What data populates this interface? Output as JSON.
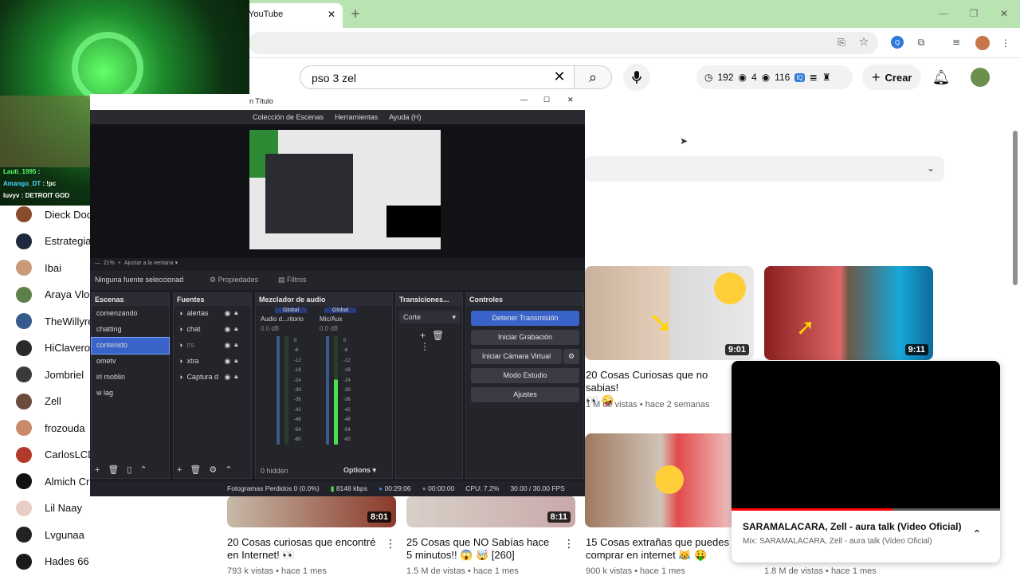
{
  "browser": {
    "tab_title": "YouTube",
    "icons": [
      "close-icon",
      "plus-icon",
      "minimize-icon",
      "maximize-icon",
      "window-close-icon",
      "star-icon",
      "extensions-icon",
      "profile-avatar"
    ]
  },
  "youtube": {
    "search_query": "pso 3 zel",
    "stats": {
      "a": "192",
      "b": "4",
      "c": "116"
    },
    "create_label": "Crear",
    "sidebar": [
      {
        "name": "Dieck Doc",
        "color": "#8a4a2e"
      },
      {
        "name": "Estrategia",
        "color": "#1d2a3e"
      },
      {
        "name": "Ibai",
        "color": "#c89a7a"
      },
      {
        "name": "Araya Vlog",
        "color": "#5f7f4a"
      },
      {
        "name": "TheWillyre",
        "color": "#355a8c"
      },
      {
        "name": "HiClavero",
        "color": "#2a2a2a"
      },
      {
        "name": "Jombriel",
        "color": "#3a3a3a"
      },
      {
        "name": "Zell",
        "color": "#6a4b3c"
      },
      {
        "name": "frozouda",
        "color": "#c98a6a"
      },
      {
        "name": "CarlosLCD",
        "color": "#b33a2a"
      },
      {
        "name": "Almich Cr",
        "color": "#111111"
      },
      {
        "name": "Lil Naay",
        "color": "#e8cfc4"
      },
      {
        "name": "Lvgunaa",
        "color": "#222222"
      },
      {
        "name": "Hades 66",
        "color": "#1a1a1a"
      }
    ],
    "videos": [
      {
        "title": "20 Cosas Curiosas que no sabias!",
        "emoji": "👀 🤪",
        "meta": "1 M de vistas • hace 2 semanas",
        "duration": "9:01"
      },
      {
        "title": "",
        "emoji": "",
        "meta": "",
        "duration": "9:11"
      },
      {
        "title": "20 Cosas curiosas que encontré en Internet! 👀",
        "meta": "793 k vistas • hace 1 mes",
        "duration": "8:01"
      },
      {
        "title": "25 Cosas que NO Sabías hace 5 minutos!! 😱 🤯 [260]",
        "meta": "1.5 M de vistas • hace 1 mes",
        "duration": "8:11"
      },
      {
        "title": "15 Cosas extrañas que puedes comprar en internet 😹 🤑",
        "meta": "900 k vistas • hace 1 mes",
        "duration": ""
      },
      {
        "title": "",
        "meta": "1.8 M de vistas • hace 1 mes",
        "duration": ""
      }
    ],
    "miniplayer": {
      "title": "SARAMALACARA, Zell - aura talk (Video Oficial)",
      "subtitle": "Mix: SARAMALACARA, Zell - aura talk (Video Oficial)",
      "progress": 0.6
    }
  },
  "stream_chat": [
    {
      "user": "Lauti_1995",
      "text": ":",
      "color": "#5dff6a"
    },
    {
      "user": "Amango_DT",
      "text": ": !pc",
      "color": "#4ad3ff"
    },
    {
      "user": "luvyv",
      "text": ": DETROIT GOD",
      "color": "#ffffff"
    }
  ],
  "obs": {
    "title": "n Título",
    "menu": [
      "Colección de Escenas",
      "Herramientas",
      "Ayuda (H)"
    ],
    "zoom": "21%",
    "fit": "Ajustar a la ventana",
    "no_source": "Ninguna fuente seleccionad",
    "properties": "Propiedades",
    "filters": "Filtros",
    "scenes_title": "Escenas",
    "scenes": [
      "comenzando",
      "chatting",
      "contenido",
      "ometv",
      "irl moblin",
      "w lag"
    ],
    "active_scene": 2,
    "sources_title": "Fuentes",
    "sources": [
      "alertas",
      "chat",
      "tts",
      "xtra",
      "Captura d"
    ],
    "mixer_title": "Mezclador de audio",
    "mixer_global": "Global",
    "mixer_channels": [
      "Audio d...ritorio",
      "Mic/Aux"
    ],
    "mixer_db": "0.0 dB",
    "mixer_scale": [
      "0",
      "-6",
      "-12",
      "-18",
      "-24",
      "-30",
      "-36",
      "-42",
      "-48",
      "-54",
      "-60"
    ],
    "hidden": "0 hidden",
    "options": "Options",
    "transitions_title": "Transiciones...",
    "transition": "Corte",
    "controls_title": "Controles",
    "controls": [
      "Detener Transmisión",
      "Iniciar Grabación",
      "Iniciar Cámara Virtual",
      "Modo Estudio",
      "Ajustes"
    ],
    "status": [
      "Fotogramas Perdidos 0 (0.0%)",
      "8148 kbps",
      "00:29:06",
      "00:00:00",
      "CPU: 7.2%",
      "30.00 / 30.00 FPS"
    ]
  }
}
